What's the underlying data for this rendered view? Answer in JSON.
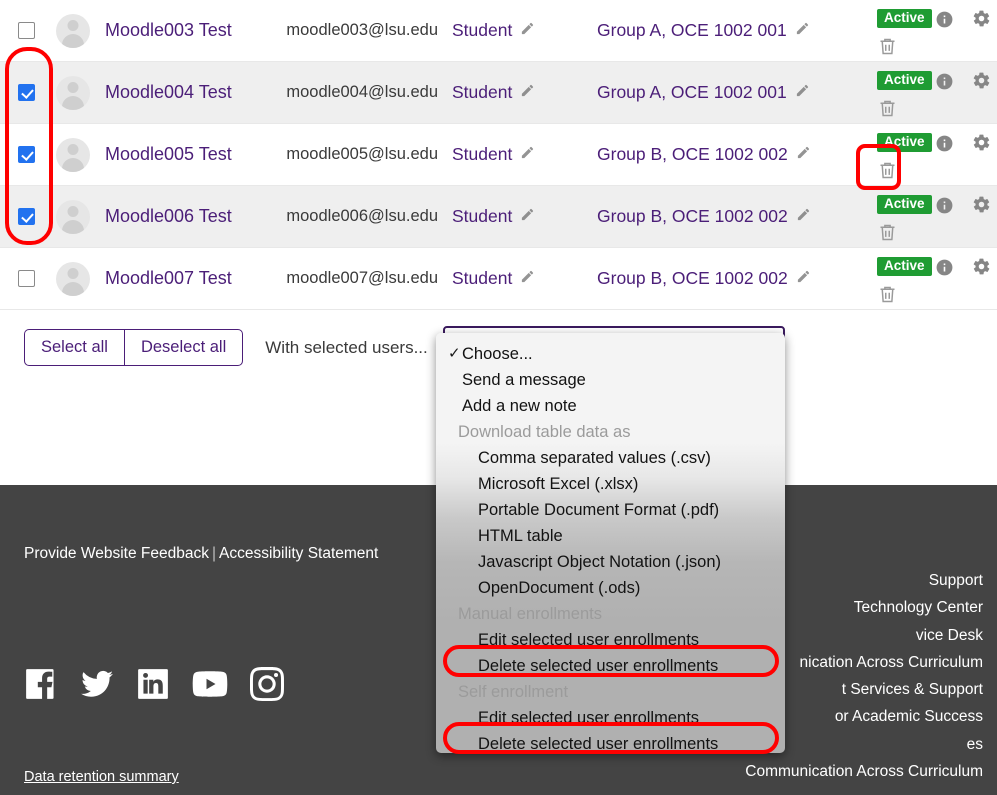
{
  "table": {
    "columns": [
      "select",
      "avatar",
      "name",
      "email",
      "roles",
      "groups",
      "status"
    ],
    "rows": [
      {
        "checked": false,
        "name": "Moodle003 Test",
        "email": "moodle003@lsu.edu",
        "role": "Student",
        "group": "Group A, OCE 1002 001",
        "status": "Active"
      },
      {
        "checked": true,
        "name": "Moodle004 Test",
        "email": "moodle004@lsu.edu",
        "role": "Student",
        "group": "Group A, OCE 1002 001",
        "status": "Active"
      },
      {
        "checked": true,
        "name": "Moodle005 Test",
        "email": "moodle005@lsu.edu",
        "role": "Student",
        "group": "Group B, OCE 1002 002",
        "status": "Active"
      },
      {
        "checked": true,
        "name": "Moodle006 Test",
        "email": "moodle006@lsu.edu",
        "role": "Student",
        "group": "Group B, OCE 1002 002",
        "status": "Active"
      },
      {
        "checked": false,
        "name": "Moodle007 Test",
        "email": "moodle007@lsu.edu",
        "role": "Student",
        "group": "Group B, OCE 1002 002",
        "status": "Active"
      }
    ]
  },
  "actionbar": {
    "select_all_label": "Select all",
    "deselect_all_label": "Deselect all",
    "with_selected_label": "With selected users..."
  },
  "dropdown": {
    "selected_value": "Choose...",
    "checkmark": "✓",
    "items": [
      {
        "label": "Choose...",
        "kind": "option",
        "selected": true
      },
      {
        "label": "Send a message",
        "kind": "option",
        "selected": false
      },
      {
        "label": "Add a new note",
        "kind": "option",
        "selected": false
      },
      {
        "label": "Download table data as",
        "kind": "group",
        "selected": false
      },
      {
        "label": "Comma separated values (.csv)",
        "kind": "sub",
        "selected": false
      },
      {
        "label": "Microsoft Excel (.xlsx)",
        "kind": "sub",
        "selected": false
      },
      {
        "label": "Portable Document Format (.pdf)",
        "kind": "sub",
        "selected": false
      },
      {
        "label": "HTML table",
        "kind": "sub",
        "selected": false
      },
      {
        "label": "Javascript Object Notation (.json)",
        "kind": "sub",
        "selected": false
      },
      {
        "label": "OpenDocument (.ods)",
        "kind": "sub",
        "selected": false
      },
      {
        "label": "Manual enrollments",
        "kind": "group",
        "selected": false
      },
      {
        "label": "Edit selected user enrollments",
        "kind": "sub",
        "selected": false
      },
      {
        "label": "Delete selected user enrollments",
        "kind": "sub",
        "selected": false
      },
      {
        "label": "Self enrollment",
        "kind": "group",
        "selected": false
      },
      {
        "label": "Edit selected user enrollments",
        "kind": "sub",
        "selected": false
      },
      {
        "label": "Delete selected user enrollments",
        "kind": "sub",
        "selected": false
      }
    ]
  },
  "footer": {
    "feedback_link": "Provide Website Feedback",
    "separator": "|",
    "accessibility_link": "Accessibility Statement",
    "retention_link": "Data retention summary",
    "social": [
      "facebook-icon",
      "twitter-icon",
      "linkedin-icon",
      "youtube-icon",
      "instagram-icon"
    ],
    "right_links": [
      "Support",
      "Technology Center",
      "vice Desk",
      "nication Across Curriculum",
      "t Services & Support",
      "or Academic Success",
      "es",
      "Communication Across Curriculum"
    ]
  },
  "annotations": {
    "checkbox_column": "red-highlight-checkbox-column",
    "row_trash": "red-highlight-trash-icon",
    "manual_delete": "red-highlight-manual-delete-enrollments",
    "self_delete": "red-highlight-self-delete-enrollments"
  },
  "colors": {
    "link": "#4b1e78",
    "badge_green": "#1f9c33",
    "checkbox_blue": "#2272ef",
    "annotation_red": "#ff0000",
    "footer_bg": "#444444"
  }
}
